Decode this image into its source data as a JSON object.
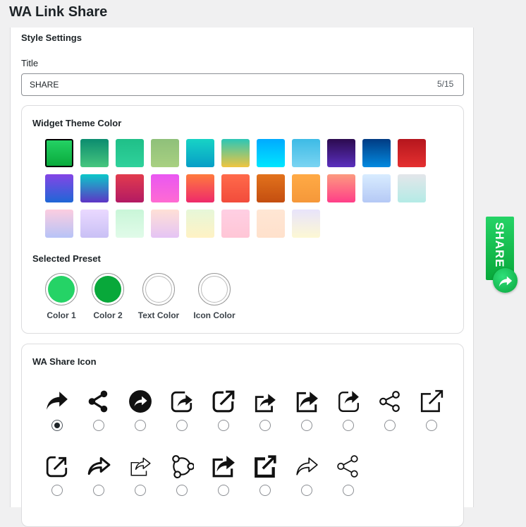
{
  "app": {
    "title": "WA Link Share"
  },
  "style_settings": {
    "heading": "Style Settings",
    "title_label": "Title",
    "title_value": "SHARE",
    "title_counter": "5/15"
  },
  "theme": {
    "heading": "Widget Theme Color",
    "selected_index": 0,
    "swatches": [
      [
        "#25d366",
        "#08a83a"
      ],
      [
        "#0b8c6f",
        "#46c67e"
      ],
      [
        "#1fbf88",
        "#2fd19b"
      ],
      [
        "#8fc07a",
        "#a8d081"
      ],
      [
        "#17d3c5",
        "#079ec7"
      ],
      [
        "#2cc6b6",
        "#f0c53f"
      ],
      [
        "#00aaff",
        "#00e6ff"
      ],
      [
        "#3dbbe6",
        "#7ad4f2"
      ],
      [
        "#2c0b4f",
        "#5a2fbe"
      ],
      [
        "#013b83",
        "#028ae0"
      ],
      [
        "#b5161d",
        "#e53030"
      ],
      [
        "#8445e6",
        "#1f67d6"
      ],
      [
        "#0cc8c8",
        "#5e35c6"
      ],
      [
        "#e23b4e",
        "#b31a63"
      ],
      [
        "#e957f2",
        "#ff6bd2"
      ],
      [
        "#ff7a3d",
        "#ee2a6b"
      ],
      [
        "#ff6a4a",
        "#f24c3c"
      ],
      [
        "#e2721c",
        "#c44e10"
      ],
      [
        "#ffaa45",
        "#f5983a"
      ],
      [
        "#fc9a7f",
        "#ff3e88"
      ],
      [
        "#d8ecff",
        "#b5c9f5"
      ],
      [
        "#e3e6ea",
        "#b4ebe6"
      ],
      [
        "#fccde0",
        "#b7c3f7"
      ],
      [
        "#ead9ff",
        "#c9c0f5"
      ],
      [
        "#c9f6d8",
        "#e1fbe9"
      ],
      [
        "#ffe0d6",
        "#e5c4f5"
      ],
      [
        "#e6f7d9",
        "#fff2c4"
      ],
      [
        "#ffcfe3",
        "#ffc6d6"
      ],
      [
        "#ffe6d4",
        "#ffe1cc"
      ],
      [
        "#e8e4fb",
        "#fdf8d4"
      ]
    ]
  },
  "preset": {
    "heading": "Selected Preset",
    "items": [
      {
        "label": "Color 1",
        "color": "#25d366"
      },
      {
        "label": "Color 2",
        "color": "#08a83a"
      },
      {
        "label": "Text Color",
        "color": "#ffffff"
      },
      {
        "label": "Icon Color",
        "color": "#ffffff"
      }
    ]
  },
  "share_icons": {
    "heading": "WA Share Icon",
    "selected_index": 0,
    "icons": [
      "share-arrow-icon",
      "share-nodes-icon",
      "share-circle-icon",
      "share-square-arrow-icon",
      "external-link-rounded-icon",
      "share-box-arrow-icon",
      "share-box-solid-icon",
      "share-box-rounded-icon",
      "share-nodes-outline-icon",
      "external-link-icon",
      "external-link-small-icon",
      "share-arrow-outline-icon",
      "share-box-thin-icon",
      "share-network-ring-icon",
      "share-box-bold-icon",
      "external-link-bold-icon",
      "share-arrow-thin-icon",
      "share-nodes-thin-icon"
    ]
  },
  "widget": {
    "label": "SHARE",
    "icon": "share-arrow-icon"
  }
}
